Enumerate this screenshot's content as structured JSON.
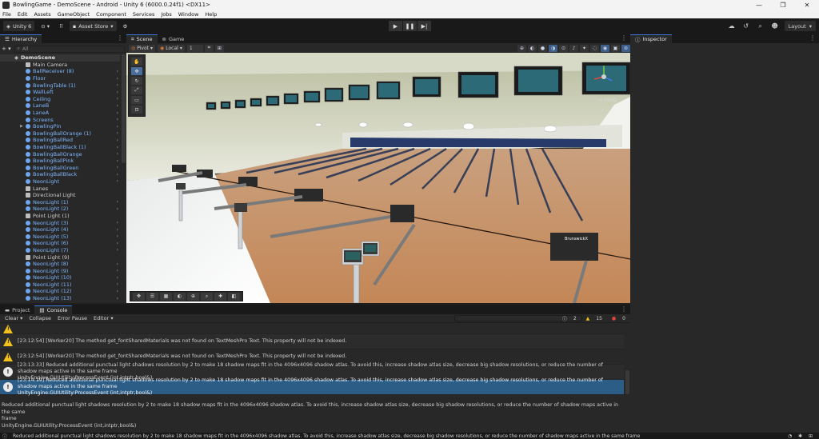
{
  "window": {
    "title": "BowlingGame - DemoScene - Android - Unity 6 (6000.0.24f1) <DX11>",
    "controls": [
      "—",
      "❐",
      "✕"
    ]
  },
  "menu": [
    "File",
    "Edit",
    "Assets",
    "GameObject",
    "Component",
    "Services",
    "Jobs",
    "Window",
    "Help"
  ],
  "toolbar": {
    "account": "Unity 6",
    "asset_store": "Asset Store",
    "layout": "Layout"
  },
  "hierarchy": {
    "tab": "Hierarchy",
    "search_placeholder": "All",
    "scene": "DemoScene",
    "items": [
      {
        "label": "Main Camera",
        "kind": "plain"
      },
      {
        "label": "BallReceiver (8)",
        "kind": "prefab"
      },
      {
        "label": "Floor",
        "kind": "prefab"
      },
      {
        "label": "BowlingTable (1)",
        "kind": "prefab"
      },
      {
        "label": "WallLeft",
        "kind": "prefab"
      },
      {
        "label": "Ceiling",
        "kind": "prefab"
      },
      {
        "label": "LaneB",
        "kind": "prefab"
      },
      {
        "label": "LaneA",
        "kind": "prefab"
      },
      {
        "label": "Screens",
        "kind": "prefab"
      },
      {
        "label": "BowlingPin",
        "kind": "prefab"
      },
      {
        "label": "BowlingBallOrange (1)",
        "kind": "prefab"
      },
      {
        "label": "BowlingBallRed",
        "kind": "prefab"
      },
      {
        "label": "BowlingBallBlack (1)",
        "kind": "prefab"
      },
      {
        "label": "BowlingBallOrange",
        "kind": "prefab"
      },
      {
        "label": "BowlingBallPink",
        "kind": "prefab"
      },
      {
        "label": "BowlingBallGreen",
        "kind": "prefab"
      },
      {
        "label": "BowlingBallBlack",
        "kind": "prefab"
      },
      {
        "label": "NeonLight",
        "kind": "prefab"
      },
      {
        "label": "Lanes",
        "kind": "plain"
      },
      {
        "label": "Directional Light",
        "kind": "plain"
      },
      {
        "label": "NeonLight (1)",
        "kind": "prefab"
      },
      {
        "label": "NeonLight (2)",
        "kind": "prefab"
      },
      {
        "label": "Point Light (1)",
        "kind": "plain"
      },
      {
        "label": "NeonLight (3)",
        "kind": "prefab"
      },
      {
        "label": "NeonLight (4)",
        "kind": "prefab"
      },
      {
        "label": "NeonLight (5)",
        "kind": "prefab"
      },
      {
        "label": "NeonLight (6)",
        "kind": "prefab"
      },
      {
        "label": "NeonLight (7)",
        "kind": "prefab"
      },
      {
        "label": "Point Light (9)",
        "kind": "plain"
      },
      {
        "label": "NeonLight (8)",
        "kind": "prefab"
      },
      {
        "label": "NeonLight (9)",
        "kind": "prefab"
      },
      {
        "label": "NeonLight (10)",
        "kind": "prefab"
      },
      {
        "label": "NeonLight (11)",
        "kind": "prefab"
      },
      {
        "label": "NeonLight (12)",
        "kind": "prefab"
      },
      {
        "label": "NeonLight (13)",
        "kind": "prefab"
      },
      {
        "label": "NeonLight (14)",
        "kind": "prefab"
      }
    ]
  },
  "scene_view": {
    "tabs": [
      "Scene",
      "Game"
    ],
    "pivot": "Pivot",
    "local": "Local",
    "grid_value": "1",
    "persp_label": "< Persp",
    "pin_deck_label": "BrunswickX"
  },
  "inspector": {
    "tab": "Inspector"
  },
  "console": {
    "tabs": [
      "Project",
      "Console"
    ],
    "toolbar": [
      "Clear",
      "Collapse",
      "Error Pause",
      "Editor"
    ],
    "counts": {
      "info": "2",
      "warn": "15",
      "error": "0"
    },
    "logs": [
      {
        "type": "warn",
        "text": "[23:12:54] [Worker20] The method get_fontSharedMaterials was not found on TextMeshPro Text. This property will not be indexed."
      },
      {
        "type": "warn",
        "text": "[23:12:54] [Worker20] The method get_fontSharedMaterials was not found on TextMeshPro Text. This property will not be indexed."
      },
      {
        "type": "info",
        "text": "[23:13:33] Reduced additional punctual light shadows resolution by 2 to make 18 shadow maps fit in the 4096x4096 shadow atlas. To avoid this, increase shadow atlas size, decrease big shadow resolutions, or reduce the number of shadow maps active in the same frame",
        "text2": "UnityEngine.GUIUtility:ProcessEvent (int,intptr,bool&)"
      },
      {
        "type": "info",
        "text": "[23:14:19] Reduced additional punctual light shadows resolution by 2 to make 18 shadow maps fit in the 4096x4096 shadow atlas. To avoid this, increase shadow atlas size, decrease big shadow resolutions, or reduce the number of shadow maps active in the same frame",
        "text2": "UnityEngine.GUIUtility:ProcessEvent (int,intptr,bool&)"
      }
    ],
    "detail": [
      "Reduced additional punctual light shadows resolution by 2 to make 18 shadow maps fit in the 4096x4096 shadow atlas. To avoid this, increase shadow atlas size, decrease big shadow resolutions, or reduce the number of shadow maps active in the same",
      "frame",
      "UnityEngine.GUIUtility:ProcessEvent (int,intptr,bool&)"
    ]
  },
  "status": "Reduced additional punctual light shadows resolution by 2 to make 18 shadow maps fit in the 4096x4096 shadow atlas. To avoid this, increase shadow atlas size, decrease big shadow resolutions, or reduce the number of shadow maps active in the same frame",
  "colors": {
    "accent": "#3d7be0",
    "selected_row": "#2c5d87",
    "prefab_text": "#7fb6ff",
    "warn": "#f3c21a"
  }
}
